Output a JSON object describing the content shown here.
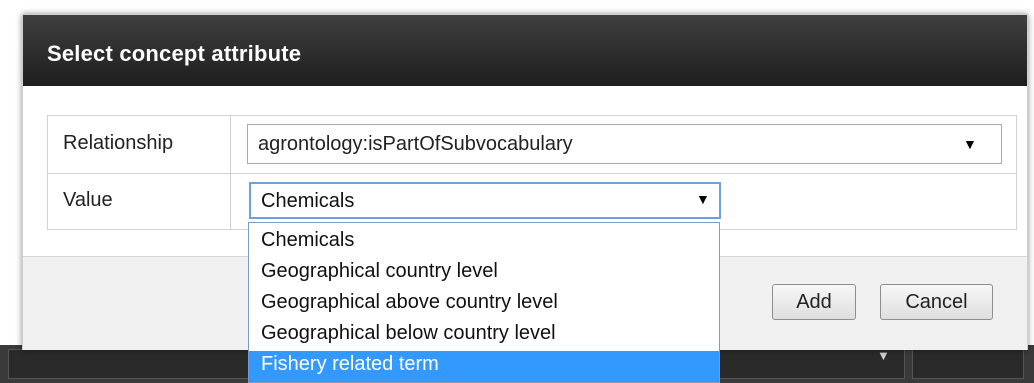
{
  "dialog": {
    "title": "Select concept attribute"
  },
  "form": {
    "relationship_label": "Relationship",
    "relationship_value": "agrontology:isPartOfSubvocabulary",
    "value_label": "Value",
    "value_selected": "Chemicals"
  },
  "dropdown": {
    "options": [
      "Chemicals",
      "Geographical country level",
      "Geographical above country level",
      "Geographical below country level",
      "Fishery related term"
    ],
    "highlighted_index": 4
  },
  "buttons": {
    "add_label": "Add",
    "cancel_label": "Cancel"
  },
  "colors": {
    "titlebar": "#2a2a2a",
    "highlight": "#3399ff"
  },
  "icons": {
    "dropdown_arrow": "chevron-down-icon"
  }
}
